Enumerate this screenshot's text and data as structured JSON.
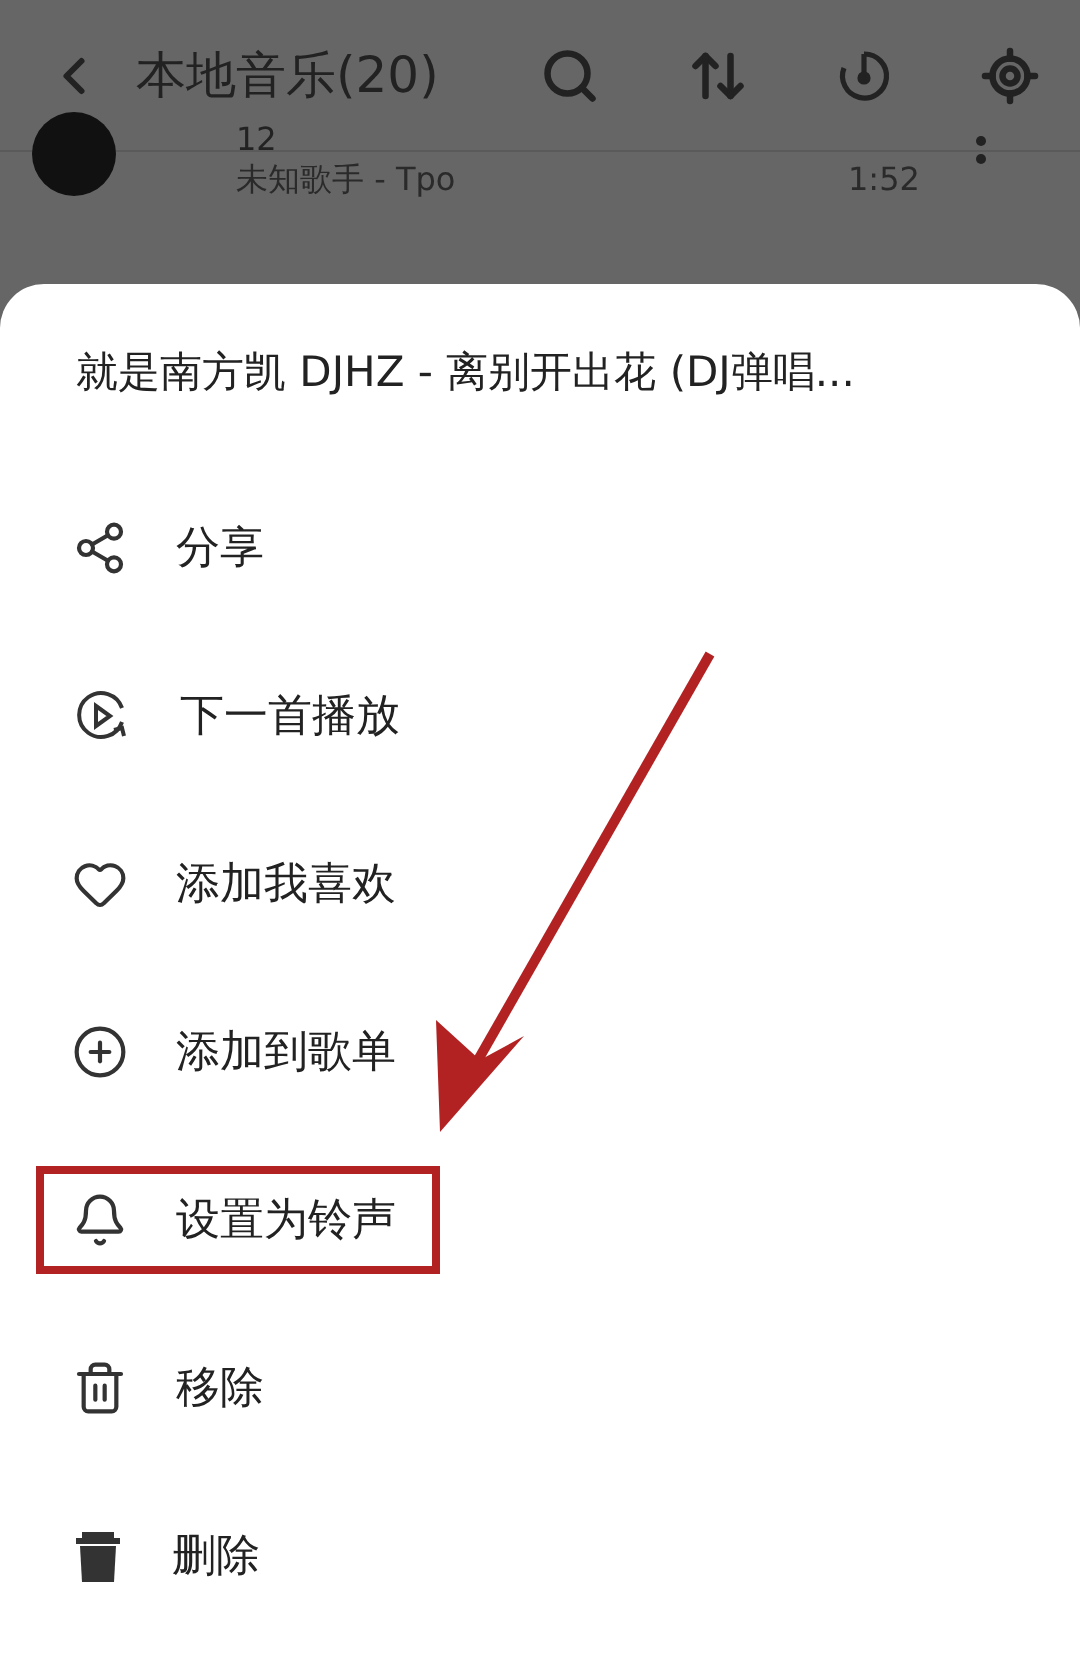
{
  "header": {
    "title": "本地音乐(20)"
  },
  "songs": [
    {
      "title": "12",
      "subtitle": "未知歌手 - Tpo",
      "duration": "1:52"
    }
  ],
  "sheet": {
    "title": "就是南方凯 DJHZ - 离别开出花 (DJ弹唱...",
    "items": [
      {
        "kind": "share",
        "label": "分享",
        "highlighted": false
      },
      {
        "kind": "next",
        "label": "下一首播放",
        "highlighted": false
      },
      {
        "kind": "like",
        "label": "添加我喜欢",
        "highlighted": false
      },
      {
        "kind": "add",
        "label": "添加到歌单",
        "highlighted": false
      },
      {
        "kind": "ringtone",
        "label": "设置为铃声",
        "highlighted": true
      },
      {
        "kind": "remove",
        "label": "移除",
        "highlighted": false
      },
      {
        "kind": "delete",
        "label": "删除",
        "highlighted": false
      }
    ]
  }
}
